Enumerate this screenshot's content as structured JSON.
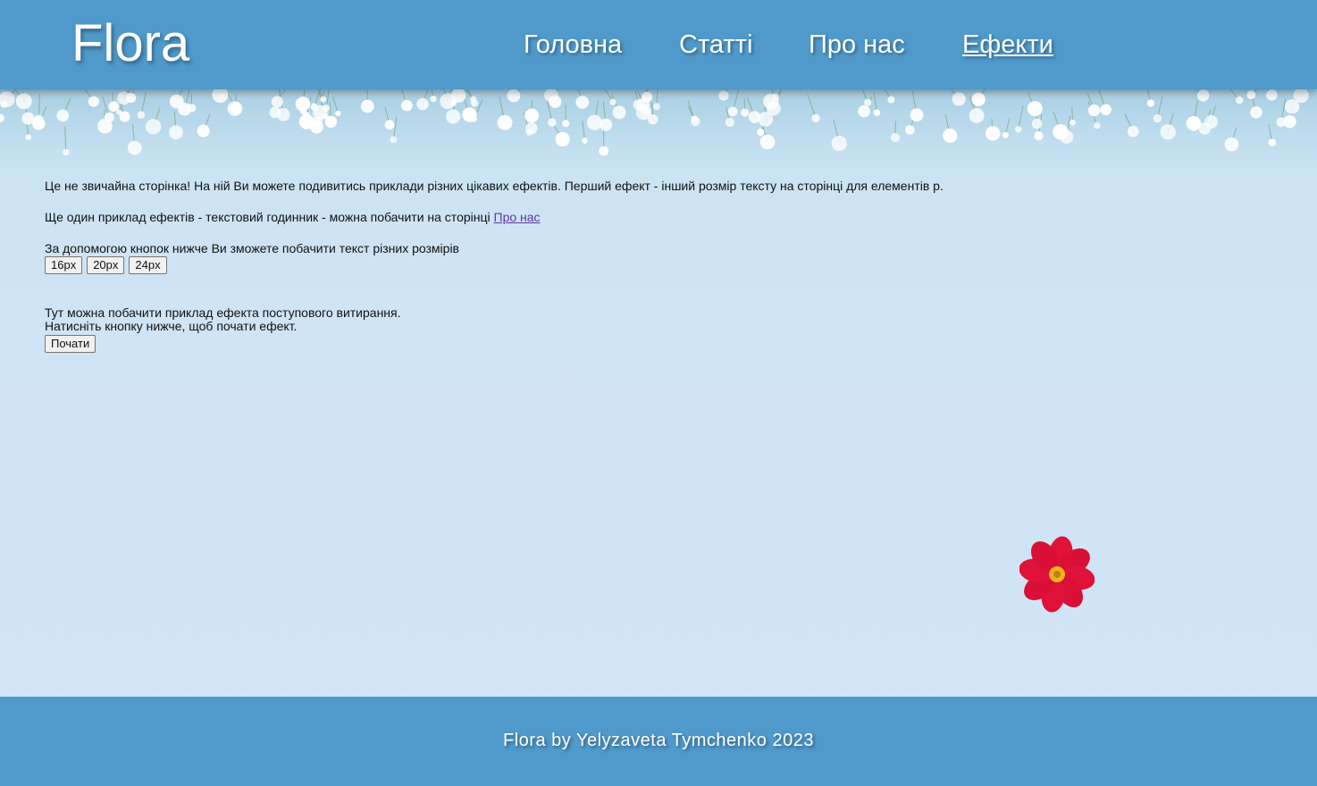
{
  "header": {
    "logo": "Flora",
    "nav": [
      {
        "label": "Головна"
      },
      {
        "label": "Статті"
      },
      {
        "label": "Про нас"
      },
      {
        "label": "Ефекти",
        "active": true
      }
    ]
  },
  "main": {
    "intro": "Це не звичайна сторінка! На ній Ви можете подивитись приклади різних цікавих ефектів. Перший ефект - інший розмір тексту на сторінці для елементів p.",
    "clock_text": "Ще один приклад ефектів - текстовий годинник - можна побачити на сторінці ",
    "clock_link": "Про нас",
    "size_text": "За допомогою кнопок нижче Ви зможете побачити текст різних розмірів",
    "size_buttons": [
      "16px",
      "20px",
      "24px"
    ],
    "fade_text_1": "Тут можна побачити приклад ефекта поступового витирання.",
    "fade_text_2": "Натисніть кнопку нижче, щоб почати ефект.",
    "start_button": "Почати"
  },
  "footer": {
    "text": "Flora by Yelyzaveta Tymchenko 2023"
  },
  "colors": {
    "header_bg": "#4f99cb",
    "page_bg": "#cfe4f5",
    "flower_red": "#e0123a"
  },
  "icons": {
    "banner": "white-flowers-banner",
    "flower": "red-cosmos-flower"
  }
}
